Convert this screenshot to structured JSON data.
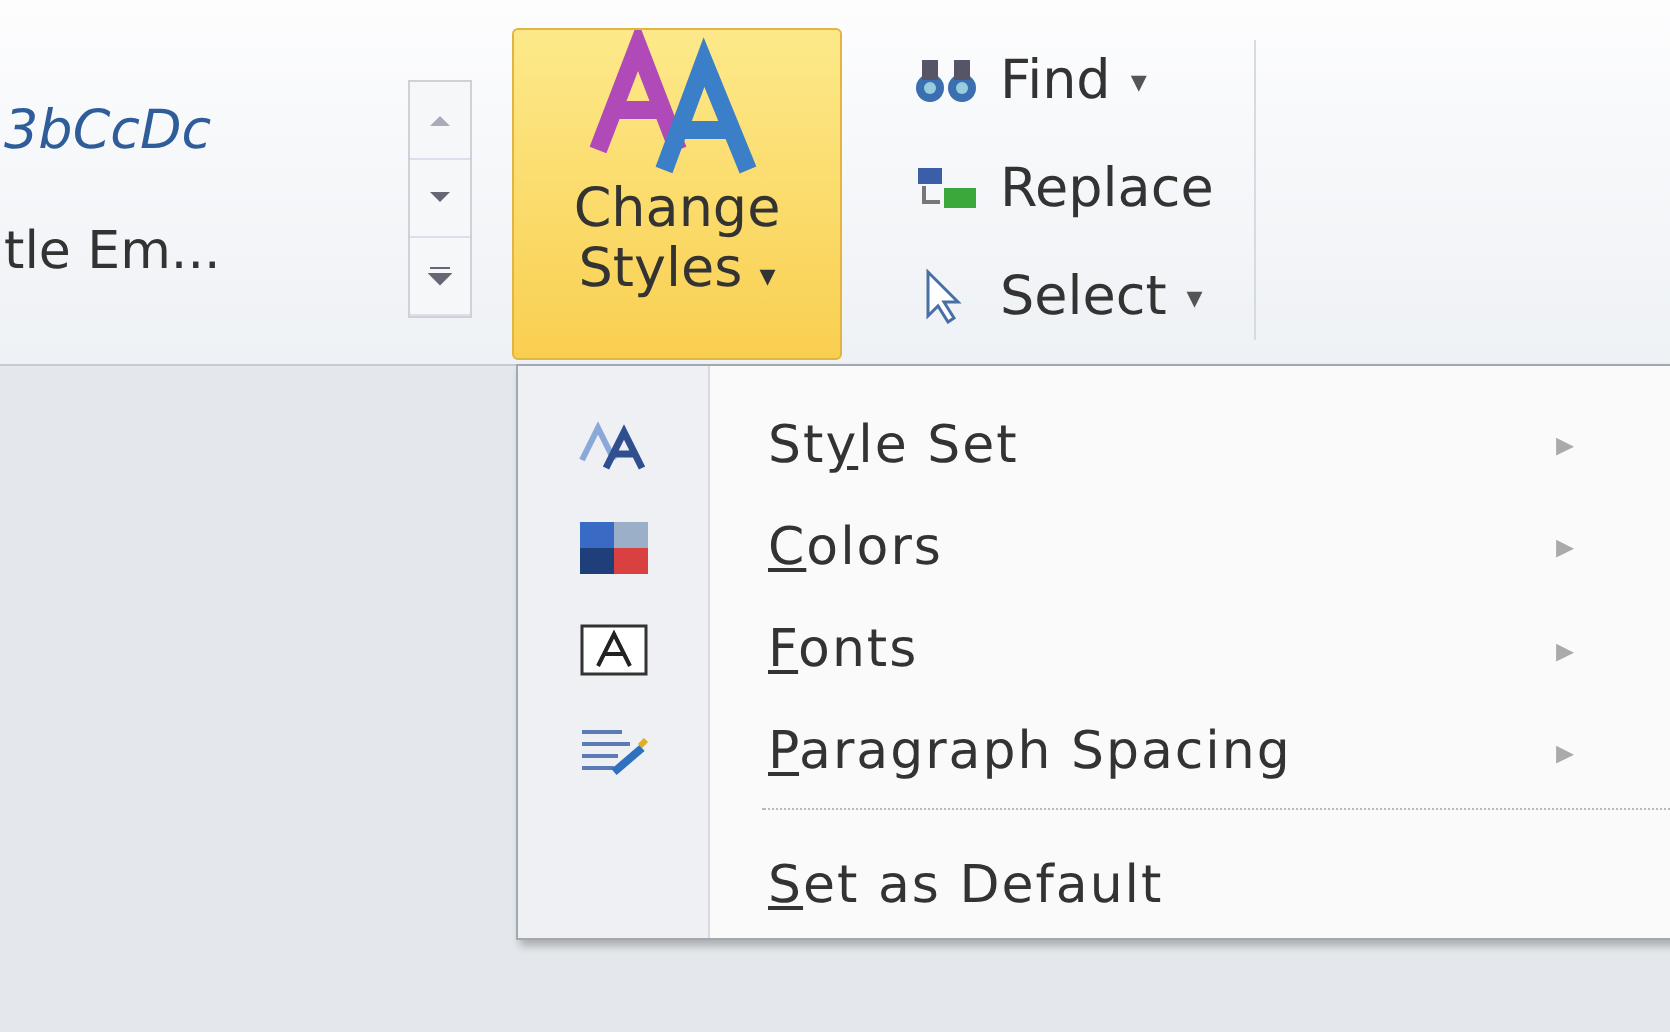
{
  "styles_gallery": {
    "items": [
      "3bCcDc",
      "tle Em..."
    ]
  },
  "change_styles_button": {
    "lines": [
      "Change",
      "Styles"
    ],
    "caret": "▾",
    "selected": true
  },
  "editing_group": [
    {
      "kind": "find",
      "label": "Find",
      "caret": "▾"
    },
    {
      "kind": "replace",
      "label": "Replace"
    },
    {
      "kind": "select",
      "label": "Select",
      "caret": "▾"
    }
  ],
  "menu": {
    "items": [
      {
        "kind": "style_set",
        "label": {
          "before": "St",
          "key": "y",
          "after": "le Set"
        },
        "submenu": "▸"
      },
      {
        "kind": "colors",
        "label": {
          "key": "C",
          "after": "olors"
        },
        "submenu": "▸"
      },
      {
        "kind": "fonts",
        "label": {
          "key": "F",
          "after": "onts"
        },
        "submenu": "▸"
      },
      {
        "kind": "spacing",
        "label": {
          "key": "P",
          "after": "aragraph Spacing"
        },
        "submenu": "▸"
      },
      {
        "kind": "separator"
      },
      {
        "kind": "default",
        "label": {
          "key": "S",
          "after": "et as Default"
        }
      }
    ]
  }
}
